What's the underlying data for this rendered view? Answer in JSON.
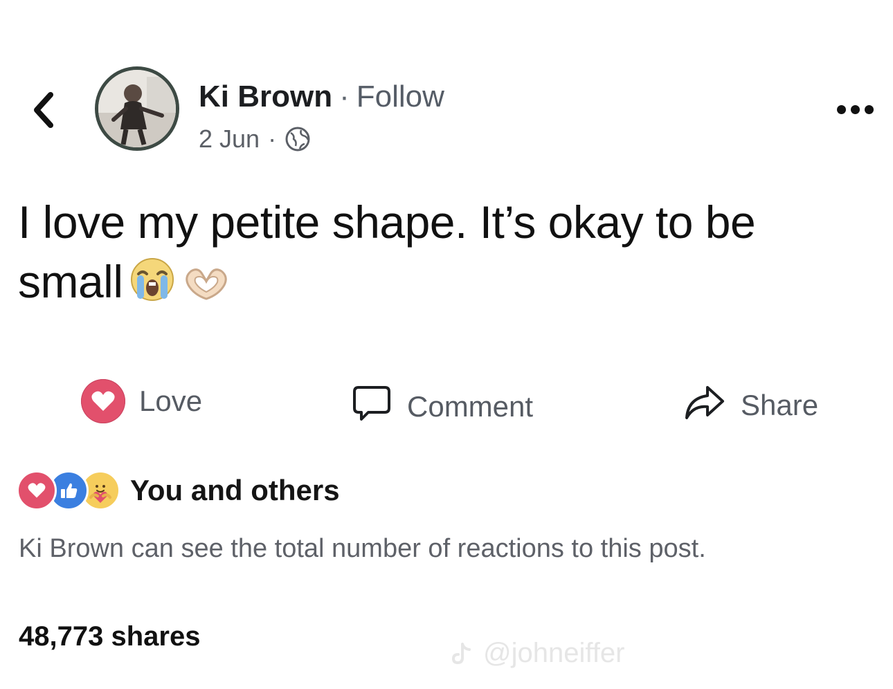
{
  "header": {
    "author_name": "Ki Brown",
    "separator": "·",
    "follow_label": "Follow",
    "date": "2 Jun",
    "meta_separator": "·",
    "audience_icon": "globe-icon"
  },
  "post": {
    "text": "I love my petite shape. It’s okay to be small",
    "emojis": [
      "loudly-crying-face",
      "heart-hands"
    ]
  },
  "actions": {
    "love_label": "Love",
    "comment_label": "Comment",
    "share_label": "Share"
  },
  "reactions": {
    "icons": [
      "love-reaction-icon",
      "like-reaction-icon",
      "care-reaction-icon"
    ],
    "label": "You and others",
    "notice": "Ki Brown can see the total number of reactions to this post."
  },
  "footer": {
    "shares": "48,773 shares"
  },
  "watermark": {
    "text": "@johneiffer"
  },
  "colors": {
    "love": "#e2506c",
    "like": "#3b7fe0",
    "care": "#f6cd5c",
    "muted_text": "#5e6168"
  }
}
